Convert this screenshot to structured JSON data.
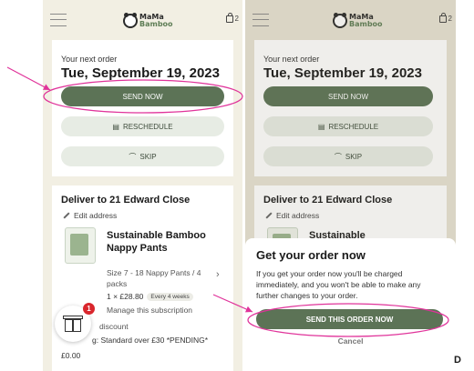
{
  "brand": {
    "name_top": "MaMa",
    "name_bottom": "Bamboo"
  },
  "cart": {
    "count": "2"
  },
  "order": {
    "label": "Your next order",
    "date": "Tue, September 19, 2023",
    "send_now": "SEND NOW",
    "reschedule": "RESCHEDULE",
    "skip": "SKIP"
  },
  "delivery": {
    "title": "Deliver to 21 Edward Close",
    "edit": "Edit address",
    "product_title": "Sustainable Bamboo Nappy Pants",
    "product_title_cut": "Sustainable",
    "size": "Size 7 - 18 Nappy Pants / 4 packs",
    "qty_price": "1 × £28.80",
    "frequency": "Every 4 weeks",
    "manage": "Manage this subscription",
    "discount": "discount",
    "shipping": "g: Standard over £30 *PENDING*",
    "price": "£0.00"
  },
  "rewards": {
    "badge": "1"
  },
  "modal": {
    "title": "Get your order now",
    "body": "If you get your order now you'll be charged immediately, and you won't be able to make any further changes to your order.",
    "send_button": "SEND THIS ORDER NOW",
    "cancel": "Cancel"
  },
  "corner_mark": "D",
  "colors": {
    "primary": "#5c7356",
    "annotation": "#e0339a",
    "badge": "#d9262c"
  }
}
